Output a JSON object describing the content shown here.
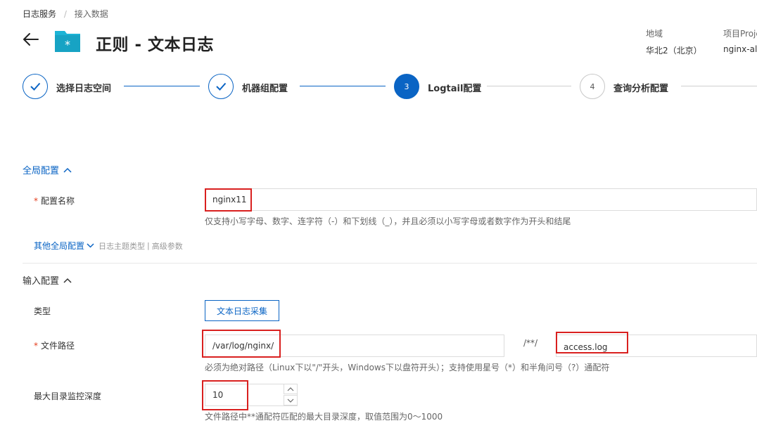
{
  "breadcrumb": {
    "root": "日志服务",
    "separator": "/",
    "current": "接入数据"
  },
  "header": {
    "title": "正则 - 文本日志",
    "region_label": "地域",
    "region_value": "华北2（北京）",
    "project_label": "项目Proje",
    "project_value": "nginx-aliy"
  },
  "steps": [
    {
      "number": "",
      "label": "选择日志空间",
      "state": "done"
    },
    {
      "number": "",
      "label": "机器组配置",
      "state": "done"
    },
    {
      "number": "3",
      "label": "Logtail配置",
      "state": "active"
    },
    {
      "number": "4",
      "label": "查询分析配置",
      "state": "pending"
    }
  ],
  "global_config": {
    "section_title": "全局配置",
    "config_name_label": "配置名称",
    "config_name_value": "nginx11",
    "config_name_hint": "仅支持小写字母、数字、连字符（-）和下划线（_），并且必须以小写字母或者数字作为开头和结尾",
    "other_link": "其他全局配置",
    "other_sub_topic": "日志主题类型",
    "other_sub_sep": "|",
    "other_sub_advanced": "高级参数"
  },
  "input_config": {
    "section_title": "输入配置",
    "type_label": "类型",
    "type_button": "文本日志采集",
    "file_path_label": "文件路径",
    "file_path_dir": "/var/log/nginx/",
    "file_path_separator": "/**/",
    "file_path_name": "access.log",
    "file_path_hint": "必须为绝对路径（Linux下以\"/\"开头，Windows下以盘符开头）；支持使用星号（*）和半角问号（?）通配符",
    "max_depth_label": "最大目录监控深度",
    "max_depth_value": "10",
    "max_depth_hint": "文件路径中**通配符匹配的最大目录深度，取值范围为0～1000"
  },
  "colors": {
    "accent": "#0a64c4",
    "highlight_box": "#d9201f",
    "required": "#e43f1f",
    "folder": "#1cb4d6"
  }
}
